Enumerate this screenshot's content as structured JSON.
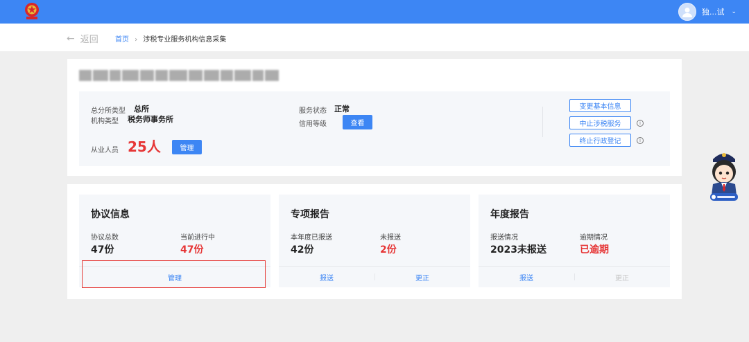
{
  "header": {
    "user_name": "独...试",
    "dropdown_glyph": "⌄",
    "emblem_icon": "national-emblem"
  },
  "breadcrumb": {
    "back_label": "返回",
    "home": "首页",
    "separator": "›",
    "current": "涉税专业服务机构信息采集"
  },
  "org": {
    "branch_type_label": "总分所类型",
    "branch_type_value": "总所",
    "org_type_label": "机构类型",
    "org_type_value": "税务师事务所",
    "staff_label": "从业人员",
    "staff_count": "25人",
    "staff_manage_button": "管理",
    "service_status_label": "服务状态",
    "service_status_value": "正常",
    "credit_label": "信用等级",
    "credit_view_button": "查看",
    "actions": [
      "变更基本信息",
      "中止涉税服务",
      "终止行政登记"
    ]
  },
  "panels": {
    "agreement": {
      "title": "协议信息",
      "total_label": "协议总数",
      "total_value": "47份",
      "ongoing_label": "当前进行中",
      "ongoing_value": "47份",
      "manage_button": "管理"
    },
    "special_report": {
      "title": "专项报告",
      "submitted_label": "本年度已报送",
      "submitted_value": "42份",
      "unsent_label": "未报送",
      "unsent_value": "2份",
      "submit_button": "报送",
      "correct_button": "更正"
    },
    "annual_report": {
      "title": "年度报告",
      "status_label": "报送情况",
      "status_value": "2023未报送",
      "overdue_label": "逾期情况",
      "overdue_value": "已逾期",
      "submit_button": "报送",
      "correct_button": "更正"
    }
  },
  "colors": {
    "primary": "#3d86f4",
    "danger": "#e63636",
    "highlight_border": "#e53935",
    "page_bg": "#efefef"
  }
}
